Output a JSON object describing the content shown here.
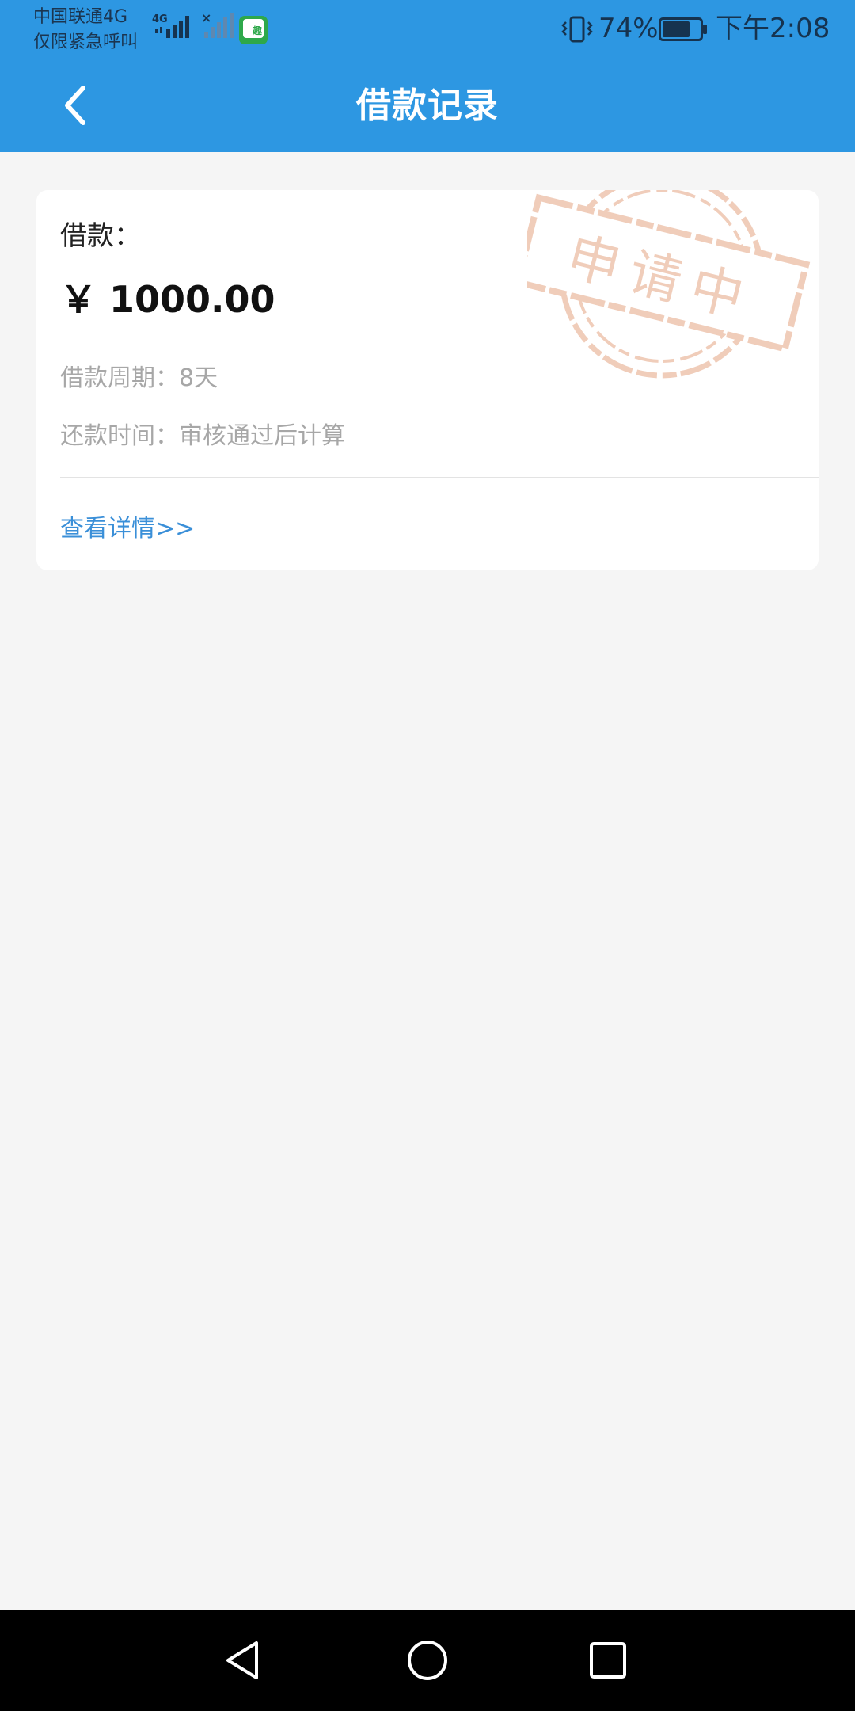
{
  "status_bar": {
    "carrier_line1": "中国联通4G",
    "carrier_line2": "仅限紧急呼叫",
    "signal_label": "4G",
    "battery_percent": "74%",
    "battery_level": 0.74,
    "time": "下午2:08",
    "app_icon_glyph": "趣",
    "icons": [
      "signal-4g-icon",
      "signal-no-service-icon",
      "app-notification-icon",
      "vibrate-icon",
      "battery-icon"
    ]
  },
  "title_bar": {
    "title": "借款记录",
    "back_icon": "chevron-left-icon"
  },
  "record": {
    "loan_label": "借款：",
    "amount": "￥ 1000.00",
    "period": "借款周期：8天",
    "repay_time": "还款时间：审核通过后计算",
    "view_details": "查看详情>>",
    "stamp_text": "申请中"
  },
  "nav_bar": {
    "icons": [
      "nav-back-icon",
      "nav-home-icon",
      "nav-recents-icon"
    ]
  },
  "colors": {
    "header_bg": "#2d97e2",
    "page_bg": "#f5f5f5",
    "card_bg": "#ffffff",
    "link": "#3a8fd8",
    "stamp": "#eab89e",
    "muted_text": "#a7a7a7",
    "nav_bar_bg": "#000000"
  }
}
